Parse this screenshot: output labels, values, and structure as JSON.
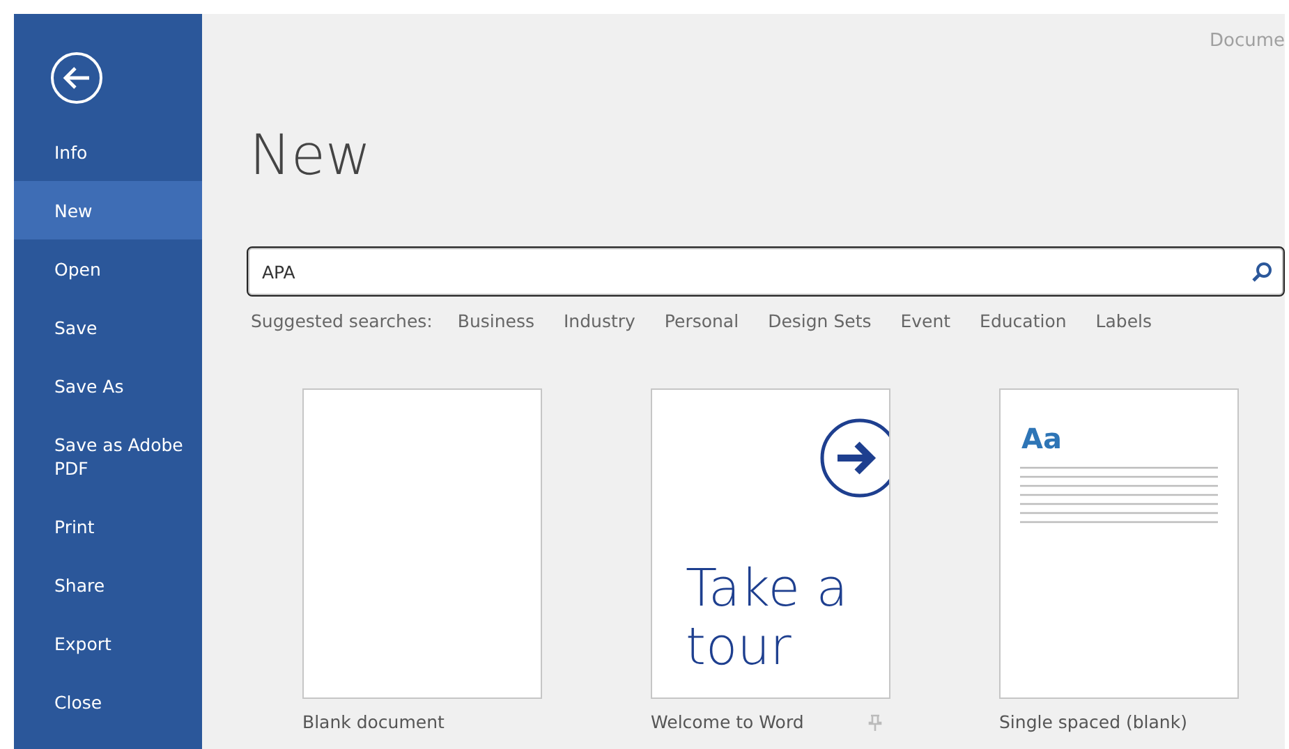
{
  "window": {
    "title": "Docume"
  },
  "sidebar": {
    "items": [
      {
        "label": "Info",
        "selected": false
      },
      {
        "label": "New",
        "selected": true
      },
      {
        "label": "Open",
        "selected": false
      },
      {
        "label": "Save",
        "selected": false
      },
      {
        "label": "Save As",
        "selected": false
      },
      {
        "label": "Save as Adobe PDF",
        "selected": false
      },
      {
        "label": "Print",
        "selected": false
      },
      {
        "label": "Share",
        "selected": false
      },
      {
        "label": "Export",
        "selected": false
      },
      {
        "label": "Close",
        "selected": false
      }
    ]
  },
  "page_title": "New",
  "search": {
    "value": "APA"
  },
  "suggested": {
    "label": "Suggested searches:",
    "items": [
      "Business",
      "Industry",
      "Personal",
      "Design Sets",
      "Event",
      "Education",
      "Labels"
    ]
  },
  "templates": [
    {
      "kind": "blank",
      "name": "Blank document",
      "pin_visible": false
    },
    {
      "kind": "tour",
      "name": "Welcome to Word",
      "thumb_text": "Take a tour",
      "pin_visible": true
    },
    {
      "kind": "lined",
      "name": "Single spaced (blank)",
      "thumb_text": "Aa",
      "pin_visible": false
    }
  ]
}
